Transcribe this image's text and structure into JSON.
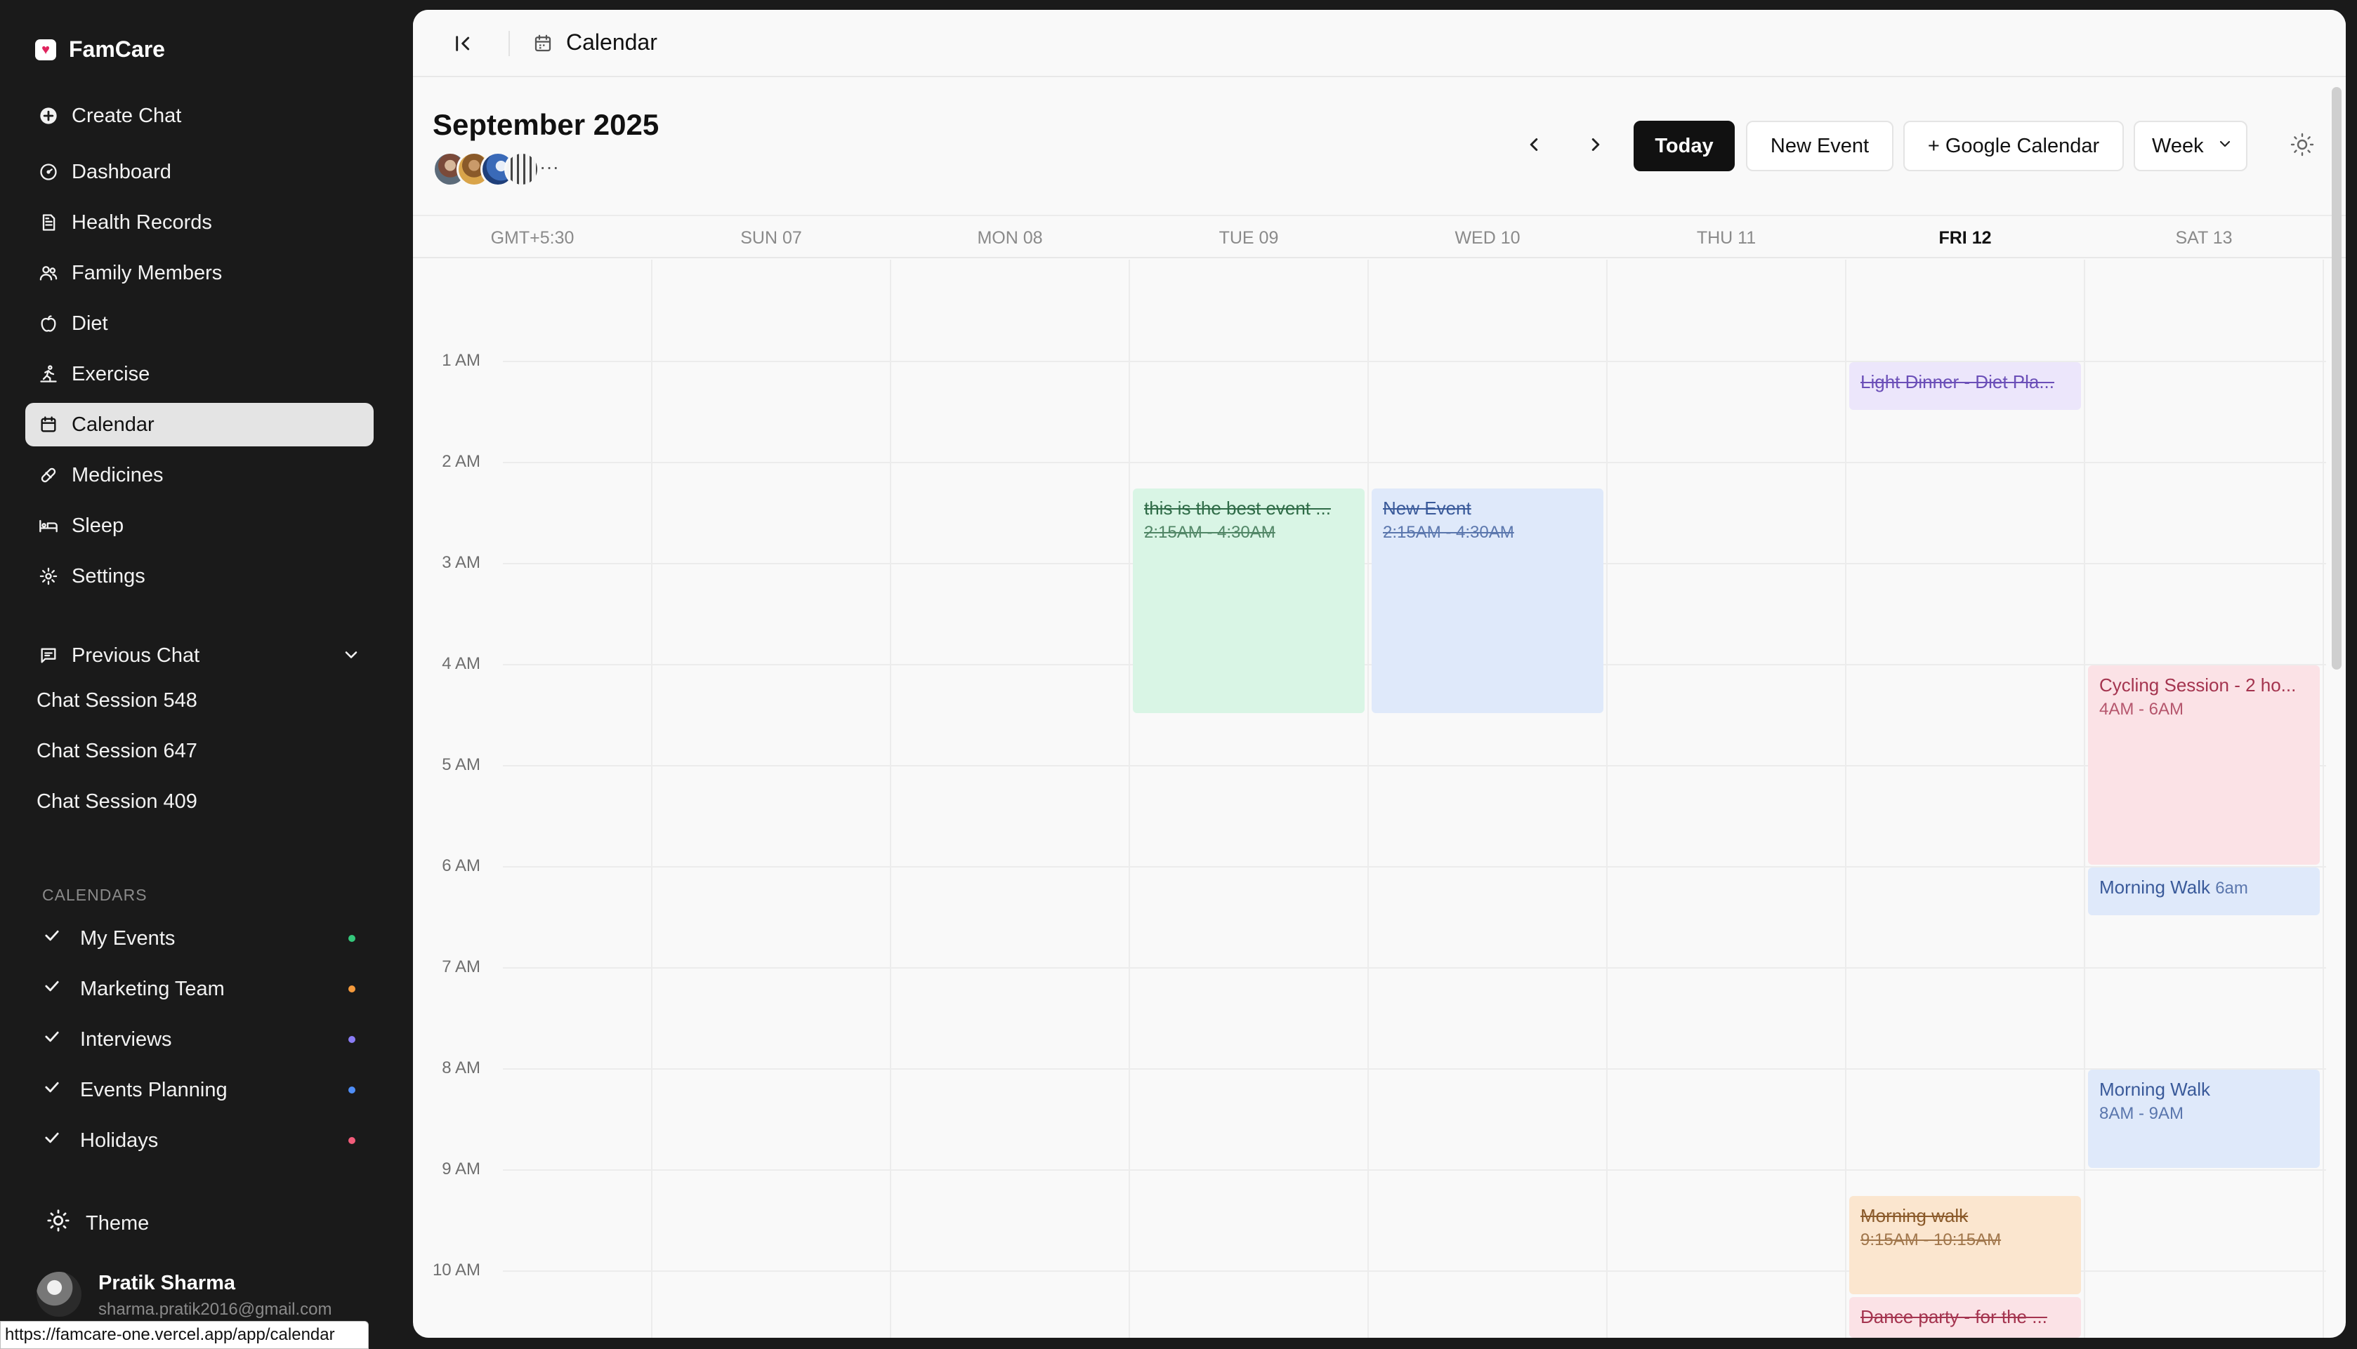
{
  "app": {
    "name": "FamCare",
    "create_chat": "Create Chat"
  },
  "sidebar": {
    "nav": [
      {
        "label": "Dashboard",
        "icon": "gauge-icon"
      },
      {
        "label": "Health Records",
        "icon": "file-text-icon"
      },
      {
        "label": "Family Members",
        "icon": "users-icon"
      },
      {
        "label": "Diet",
        "icon": "apple-icon"
      },
      {
        "label": "Exercise",
        "icon": "running-icon"
      },
      {
        "label": "Calendar",
        "icon": "calendar-icon",
        "active": true
      },
      {
        "label": "Medicines",
        "icon": "pill-icon"
      },
      {
        "label": "Sleep",
        "icon": "bed-icon"
      },
      {
        "label": "Settings",
        "icon": "gear-icon"
      }
    ],
    "previous_chat": {
      "label": "Previous Chat",
      "sessions": [
        "Chat Session 548",
        "Chat Session 647",
        "Chat Session 409"
      ]
    },
    "calendars": {
      "heading": "CALENDARS",
      "items": [
        {
          "label": "My Events",
          "color": "#34c77b"
        },
        {
          "label": "Marketing Team",
          "color": "#f59a3c"
        },
        {
          "label": "Interviews",
          "color": "#8a7cf5"
        },
        {
          "label": "Events Planning",
          "color": "#4f8ef7"
        },
        {
          "label": "Holidays",
          "color": "#f25c7a"
        }
      ]
    },
    "theme_label": "Theme",
    "user": {
      "name": "Pratik Sharma",
      "email": "sharma.pratik2016@gmail.com"
    }
  },
  "status_url": "https://famcare-one.vercel.app/app/calendar",
  "topbar": {
    "title": "Calendar"
  },
  "calendar": {
    "month_title": "September 2025",
    "more_attendees": "···",
    "today_button": "Today",
    "new_event_button": "New Event",
    "google_button": "+ Google Calendar",
    "view_select": "Week",
    "timezone": "GMT+5:30",
    "days": [
      {
        "label": "SUN 07",
        "today": false
      },
      {
        "label": "MON 08",
        "today": false
      },
      {
        "label": "TUE 09",
        "today": false
      },
      {
        "label": "WED 10",
        "today": false
      },
      {
        "label": "THU 11",
        "today": false
      },
      {
        "label": "FRI 12",
        "today": true
      },
      {
        "label": "SAT 13",
        "today": false
      }
    ],
    "hours": [
      "1 AM",
      "2 AM",
      "3 AM",
      "4 AM",
      "5 AM",
      "6 AM",
      "7 AM",
      "8 AM",
      "9 AM",
      "10 AM"
    ],
    "events": [
      {
        "day": 2,
        "start": 2.25,
        "end": 4.5,
        "title": "this is the best event ...",
        "time": "2:15AM - 4:30AM",
        "completed": true,
        "bg": "#d9f5e5",
        "fg": "#2f6b47"
      },
      {
        "day": 3,
        "start": 2.25,
        "end": 4.5,
        "title": "New Event",
        "time": "2:15AM - 4:30AM",
        "completed": true,
        "bg": "#dfe9fa",
        "fg": "#3a5a9a"
      },
      {
        "day": 5,
        "start": 1.0,
        "end": 1.5,
        "title": "Light Dinner - Diet Pla...",
        "time": "",
        "completed": true,
        "bg": "#ece6fb",
        "fg": "#6b4fb8"
      },
      {
        "day": 6,
        "start": 4.0,
        "end": 6.0,
        "title": "Cycling Session - 2 ho...",
        "time": "4AM - 6AM",
        "completed": false,
        "bg": "#fbe2e6",
        "fg": "#a4344f"
      },
      {
        "day": 6,
        "start": 6.0,
        "end": 6.5,
        "title": "Morning Walk",
        "time": "6am",
        "completed": false,
        "inline": true,
        "bg": "#dfe9fa",
        "fg": "#3a5a9a"
      },
      {
        "day": 6,
        "start": 8.0,
        "end": 9.0,
        "title": "Morning Walk",
        "time": "8AM - 9AM",
        "completed": false,
        "bg": "#dfe9fa",
        "fg": "#3a5a9a"
      },
      {
        "day": 5,
        "start": 9.25,
        "end": 10.25,
        "title": "Morning walk",
        "time": "9:15AM - 10:15AM",
        "completed": true,
        "bg": "#fbe6cf",
        "fg": "#8a5a2a"
      },
      {
        "day": 5,
        "start": 10.25,
        "end": 11.0,
        "title": "Dance party - for the ...",
        "time": "",
        "completed": true,
        "bg": "#fbe2e6",
        "fg": "#a4344f"
      }
    ]
  }
}
